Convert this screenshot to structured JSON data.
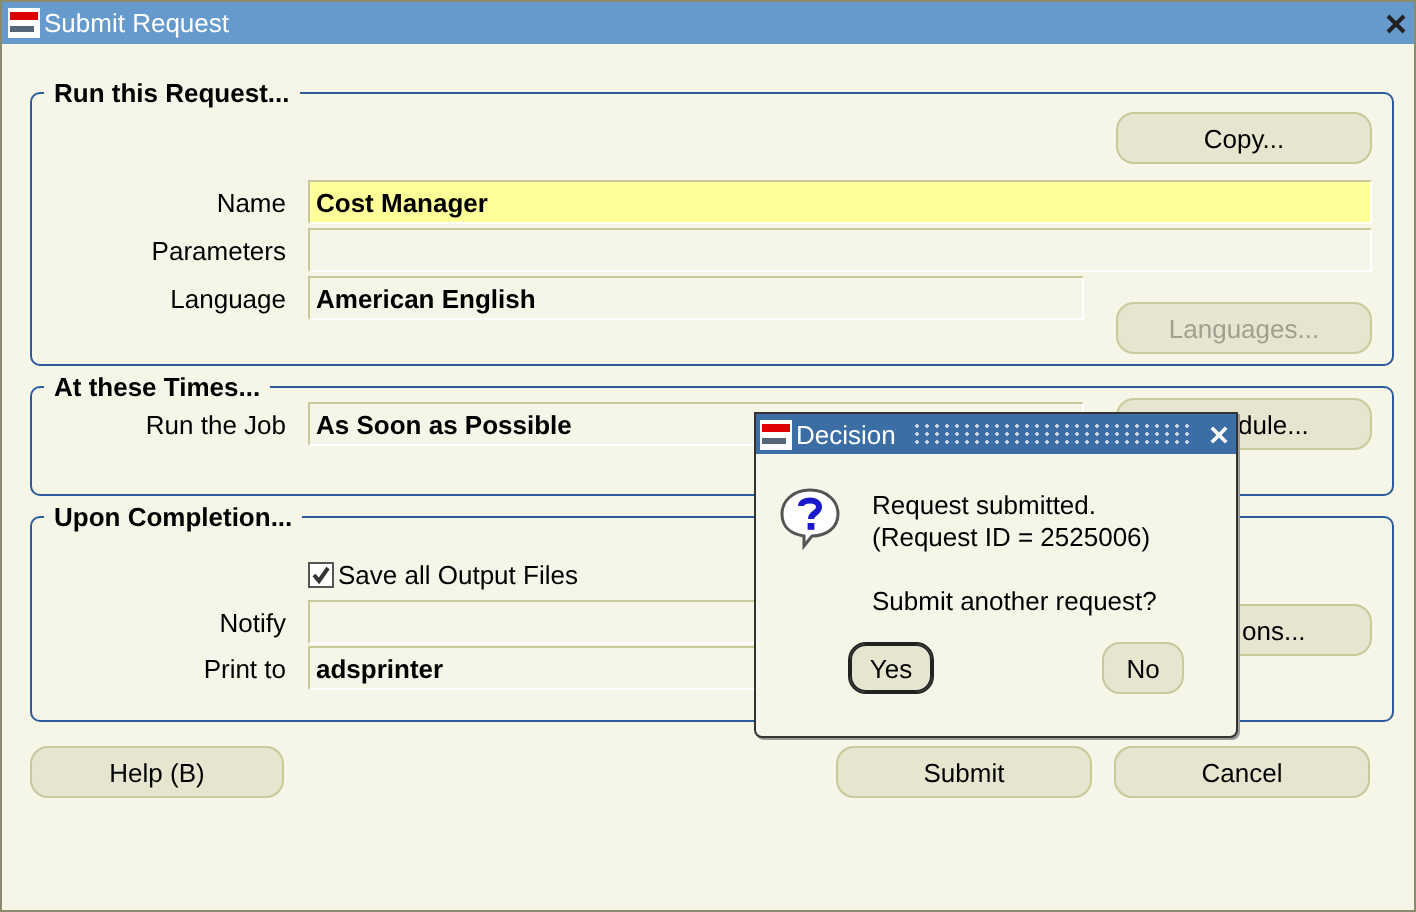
{
  "window": {
    "title": "Submit Request"
  },
  "run_request": {
    "title": "Run this Request...",
    "copy_button": {
      "label": "Copy..."
    },
    "fields": [
      {
        "label": "Name",
        "value": "Cost Manager",
        "required": true
      },
      {
        "label": "Parameters",
        "required": false
      },
      {
        "label": "Language",
        "value": "American English",
        "required": false
      }
    ],
    "languages_button": {
      "label": "Languages...",
      "disabled": true
    }
  },
  "times": {
    "title": "At these Times...",
    "fields": [
      {
        "label": "Run the Job",
        "value": "As Soon as Possible"
      }
    ],
    "schedule_button": {
      "label": "dule..."
    }
  },
  "completion": {
    "title": "Upon Completion...",
    "save_output": {
      "label": "Save all Output Files",
      "checked": true
    },
    "fields": [
      {
        "label": "Notify"
      },
      {
        "label": "Print to",
        "value": "adsprinter"
      }
    ],
    "options_button": {
      "label": "ons..."
    }
  },
  "buttons": [
    {
      "label": "Help (B)"
    },
    {
      "label": "Submit"
    },
    {
      "label": "Cancel"
    }
  ],
  "dialog": {
    "title": "Decision",
    "message": [
      "Request submitted.",
      "(Request ID = 2525006)"
    ],
    "question": "Submit another request?",
    "buttons": [
      {
        "label": "Yes",
        "selected": true
      },
      {
        "label": "No",
        "selected": false
      }
    ]
  }
}
